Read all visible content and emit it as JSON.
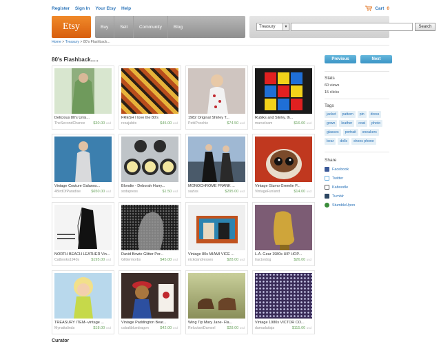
{
  "top_links": [
    "Register",
    "Sign In",
    "Your Etsy",
    "Help"
  ],
  "cart": {
    "label": "Cart",
    "count": "0"
  },
  "logo": "Etsy",
  "nav": [
    "Buy",
    "Sell",
    "Community",
    "Blog"
  ],
  "search": {
    "category": "Treasury",
    "query": "",
    "button": "Search"
  },
  "breadcrumb": {
    "home": "Home",
    "treasury": "Treasury",
    "current": "80's Flashback..."
  },
  "page_title": "80's Flashback.....",
  "pager": {
    "prev": "Previous",
    "next": "Next"
  },
  "stats": {
    "heading": "Stats",
    "views": "60 views",
    "clicks": "15 clicks"
  },
  "tags": {
    "heading": "Tags",
    "items": [
      "jacket",
      "pattern",
      "pin",
      "dress",
      "gown",
      "leather",
      "coat",
      "photo",
      "glasses",
      "portrait",
      "sneakers",
      "bear",
      "dolls",
      "shoes phone"
    ]
  },
  "share": {
    "heading": "Share",
    "items": [
      "Facebook",
      "Twitter",
      "Kaboodle",
      "Tumblr",
      "StumbleUpon"
    ]
  },
  "curator": "Curator",
  "items": [
    {
      "title": "Delicious 80's Unis...",
      "shop": "TheSecondChance",
      "price": "$30.00",
      "currency": "usd"
    },
    {
      "title": "FRESH I love the 80's",
      "shop": "rexajubits",
      "price": "$45.00",
      "currency": "usd"
    },
    {
      "title": "1982 Original Shirley T...",
      "shop": "PettiPoochie",
      "price": "$74.50",
      "currency": "usd"
    },
    {
      "title": "Rubiks and Slinky, th...",
      "shop": "marvelcam",
      "price": "$16.00",
      "currency": "usd"
    },
    {
      "title": "Vintage Couture Galanos...",
      "shop": "4BirdOfParadise",
      "price": "$650.00",
      "currency": "usd"
    },
    {
      "title": "Blondie - Deborah Harry...",
      "shop": "sodapress",
      "price": "$1.50",
      "currency": "usd"
    },
    {
      "title": "MONOCHROME FRANK ...",
      "shop": "sazlas",
      "price": "$295.00",
      "currency": "usd"
    },
    {
      "title": "Vintage Gizmo Gremlin P...",
      "shop": "VintageFunland",
      "price": "$14.00",
      "currency": "usd"
    },
    {
      "title": "NORTH BEACH LEATHER Vin...",
      "shop": "Catbooks1940s",
      "price": "$195.00",
      "currency": "usd"
    },
    {
      "title": "David Bowie Glitter Por...",
      "shop": "Glittermorbs",
      "price": "$45.00",
      "currency": "usd"
    },
    {
      "title": "Vintage 80s MIAMI VICE ...",
      "shop": "nickdandresses",
      "price": "$28.00",
      "currency": "usd"
    },
    {
      "title": "L.A. Gear 1980s HIP HOP...",
      "shop": "tractordog",
      "price": "$26.00",
      "currency": "usd"
    },
    {
      "title": "TREASURY ITEM--vintage ...",
      "shop": "Mynattalinda",
      "price": "$18.00",
      "currency": "usd"
    },
    {
      "title": "Vintage Paddington Bear...",
      "shop": "cobaltbluedragon",
      "price": "$42.00",
      "currency": "usd"
    },
    {
      "title": "Wing Tip Mary Jane- Fla...",
      "shop": "ReluctantDamsel",
      "price": "$28.00",
      "currency": "usd"
    },
    {
      "title": "Vintage 1980s VICTOR CO...",
      "shop": "damadaitaja",
      "price": "$115.00",
      "currency": "usd"
    }
  ],
  "colors": {
    "accent": "#e0701c",
    "link": "#2a73b8",
    "price": "#6aa35e",
    "button": "#3a94c6"
  }
}
